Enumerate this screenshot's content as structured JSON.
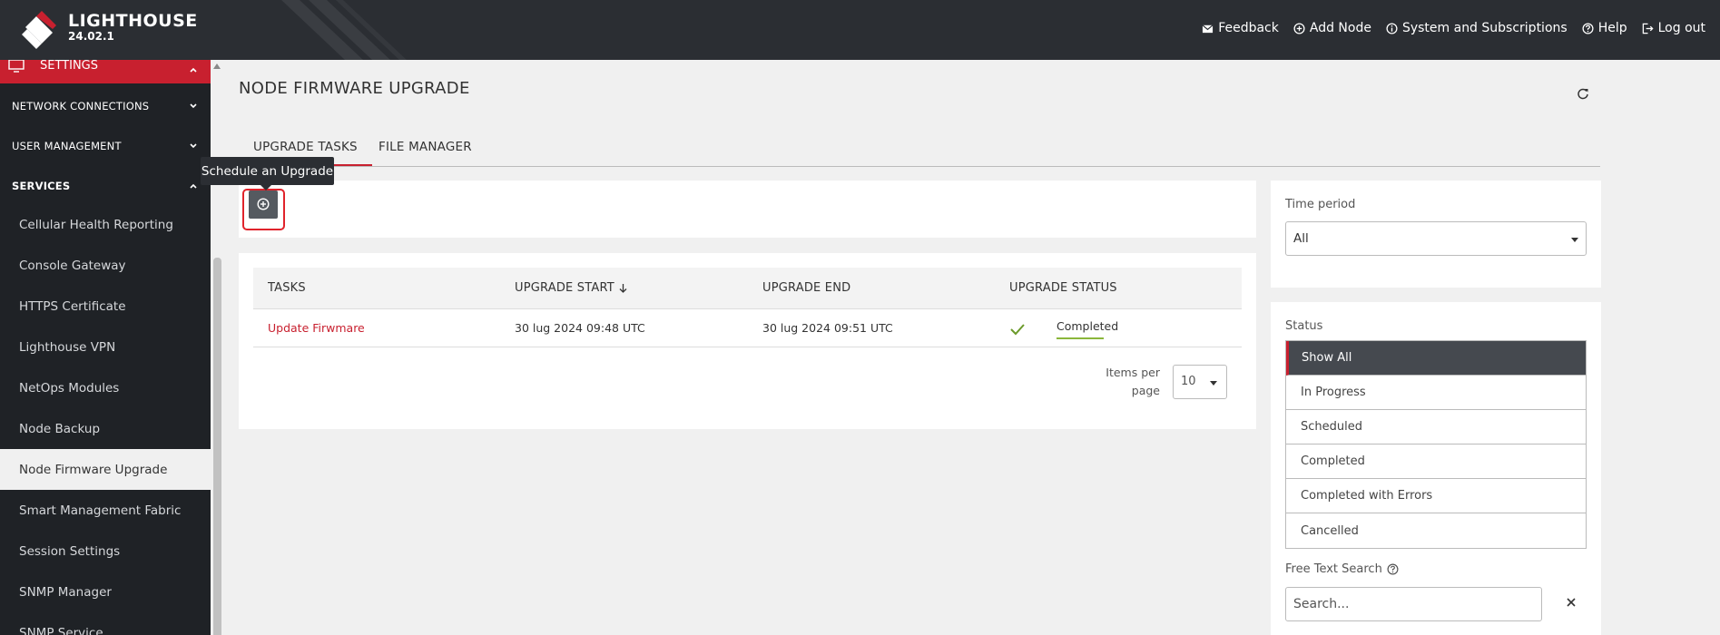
{
  "header": {
    "brand_name": "LIGHTHOUSE",
    "version": "24.02.1",
    "nav": [
      {
        "label": "Feedback",
        "icon": "mail-icon"
      },
      {
        "label": "Add Node",
        "icon": "plus-circle-icon"
      },
      {
        "label": "System and Subscriptions",
        "icon": "info-icon"
      },
      {
        "label": "Help",
        "icon": "help-icon"
      },
      {
        "label": "Log out",
        "icon": "logout-icon"
      }
    ]
  },
  "sidebar": {
    "settings_label": "SETTINGS",
    "sections": [
      "NETWORK CONNECTIONS",
      "USER MANAGEMENT",
      "SERVICES"
    ],
    "items": [
      "Cellular Health Reporting",
      "Console Gateway",
      "HTTPS Certificate",
      "Lighthouse VPN",
      "NetOps Modules",
      "Node Backup",
      "Node Firmware Upgrade",
      "Smart Management Fabric",
      "Session Settings",
      "SNMP Manager",
      "SNMP Service"
    ],
    "active_item": "Node Firmware Upgrade"
  },
  "main": {
    "title": "NODE FIRMWARE UPGRADE",
    "tabs": [
      "UPGRADE TASKS",
      "FILE MANAGER"
    ],
    "tooltip": "Schedule an Upgrade",
    "table": {
      "headers": [
        "TASKS",
        "UPGRADE START",
        "UPGRADE END",
        "UPGRADE STATUS"
      ],
      "rows": [
        {
          "task": "Update Firwmare",
          "start": "30 lug 2024 09:48 UTC",
          "end": "30 lug 2024 09:51 UTC",
          "status": "Completed"
        }
      ]
    },
    "items_per_page_label_1": "Items per",
    "items_per_page_label_2": "page",
    "items_per_page_value": "10"
  },
  "filters": {
    "time_period_label": "Time period",
    "time_period_value": "All",
    "status_label": "Status",
    "status_options": [
      "Show All",
      "In Progress",
      "Scheduled",
      "Completed",
      "Completed with Errors",
      "Cancelled"
    ],
    "search_label": "Free Text Search",
    "search_placeholder": "Search..."
  },
  "colors": {
    "brand_red": "#c8202f",
    "header_bg": "#2b2e33",
    "sidebar_bg": "#1f2226",
    "success_green": "#8bb73b"
  }
}
